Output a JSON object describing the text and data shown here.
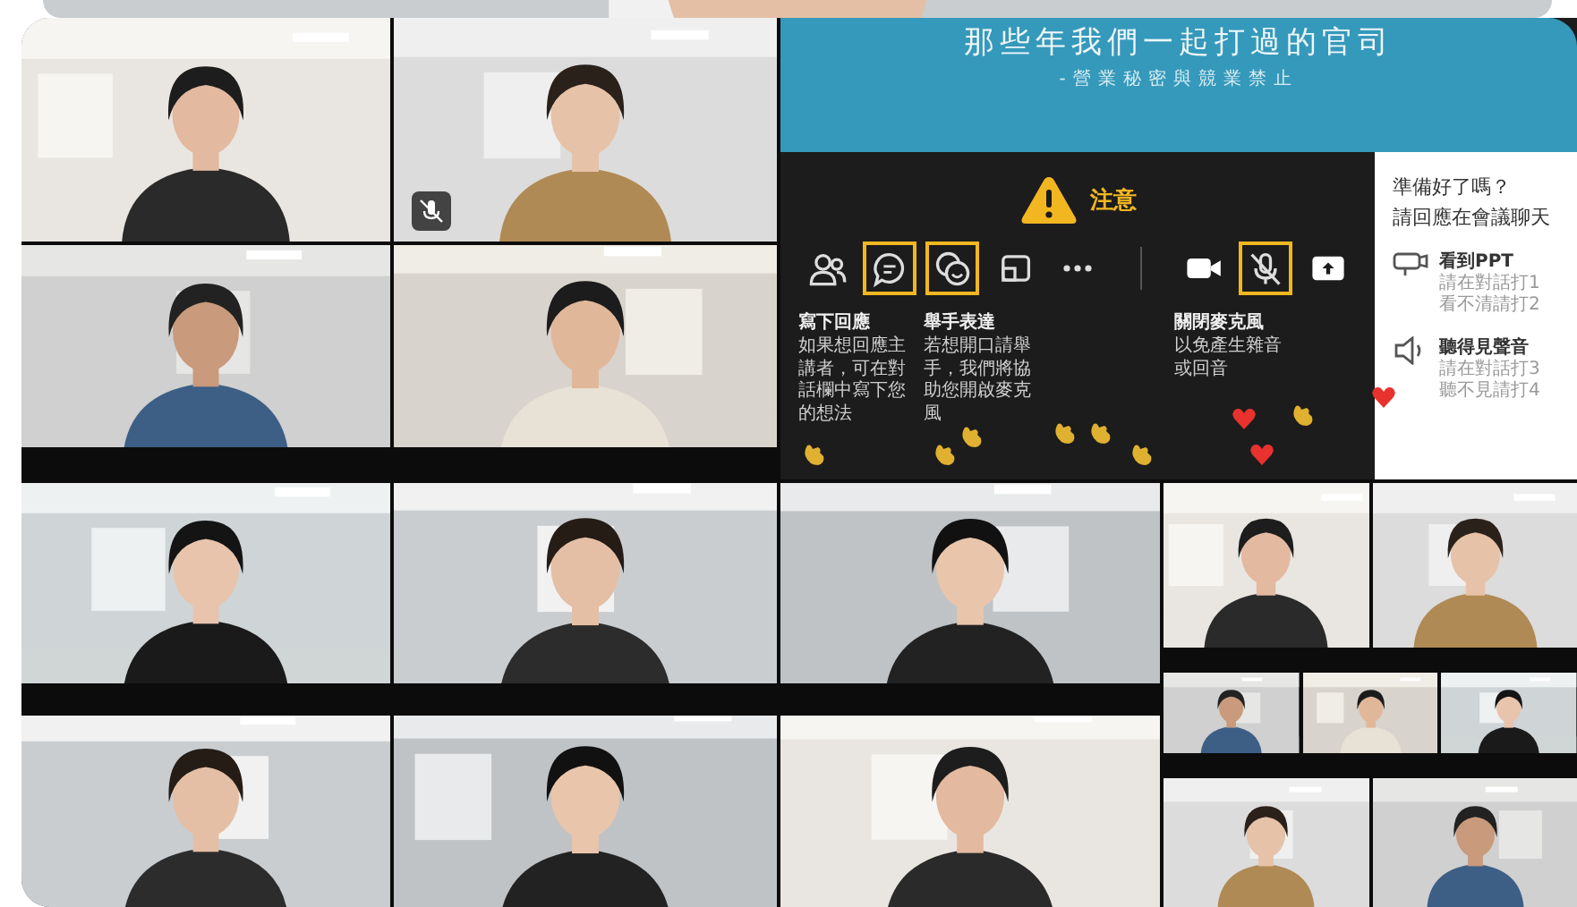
{
  "top_strip": {
    "kind": "picture"
  },
  "slide": {
    "title": "那些年我們一起打過的官司",
    "subtitle": "-營業秘密與競業禁止",
    "notice": "注意",
    "toolbar": [
      {
        "kind": "people",
        "highlighted": false
      },
      {
        "kind": "chat",
        "highlighted": true
      },
      {
        "kind": "emoji",
        "highlighted": true
      },
      {
        "kind": "screen",
        "highlighted": false
      },
      {
        "kind": "more",
        "highlighted": false
      },
      {
        "kind": "divider"
      },
      {
        "kind": "camera",
        "highlighted": false
      },
      {
        "kind": "mic-off",
        "highlighted": true
      },
      {
        "kind": "share",
        "highlighted": false
      }
    ],
    "captions": [
      {
        "title": "寫下回應",
        "text": "如果想回應主講者，可在對話欄中寫下您的想法"
      },
      {
        "title": "舉手表達",
        "text": "若想開口請舉手，我們將協助您開啟麥克風"
      },
      {
        "title": "關閉麥克風",
        "text": "以免產生雜音或回音"
      }
    ],
    "panel": {
      "heading": "準備好了嗎？",
      "prompt": "請回應在會議聊天",
      "items": [
        {
          "kind": "projector",
          "title": "看到PPT",
          "lines": [
            "請在對話打1",
            "看不清請打2"
          ]
        },
        {
          "kind": "speaker",
          "title": "聽得見聲音",
          "lines": [
            "請在對話打3",
            "聽不見請打4"
          ]
        }
      ]
    }
  },
  "participants": [
    {
      "kind": "picture",
      "muted": false
    },
    {
      "kind": "picture",
      "muted": true
    },
    {
      "kind": "picture",
      "muted": false
    },
    {
      "kind": "picture",
      "muted": false
    },
    {
      "kind": "picture",
      "muted": false
    },
    {
      "kind": "picture",
      "muted": false
    },
    {
      "kind": "picture",
      "muted": false
    },
    {
      "kind": "picture",
      "muted": false
    },
    {
      "kind": "picture",
      "muted": false
    },
    {
      "kind": "picture",
      "muted": false
    },
    {
      "kind": "picture",
      "muted": false
    },
    {
      "kind": "picture",
      "muted": false
    },
    {
      "kind": "picture",
      "muted": false
    },
    {
      "kind": "picture",
      "muted": false
    },
    {
      "kind": "picture",
      "muted": false
    },
    {
      "kind": "picture",
      "muted": false
    },
    {
      "kind": "picture",
      "muted": false
    }
  ]
}
